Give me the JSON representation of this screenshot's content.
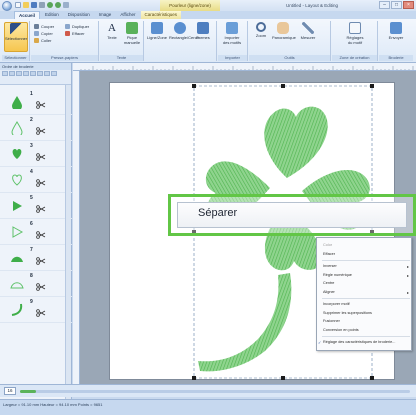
{
  "titlebar": {
    "contextual_tab_group": "Pourleur (ligne/zone)",
    "window_title": "Untitled - Layout & Editing"
  },
  "tabs": [
    "Accueil",
    "Edition",
    "Disposition",
    "Image",
    "Afficher",
    "Caractéristiques"
  ],
  "ribbon": {
    "groups": {
      "selection": "Sélectionner",
      "clipboard": "Presse-papiers",
      "text": "Texte",
      "import": "Importer",
      "tools": "Outils",
      "zone": "Zone de création",
      "embroidery": "Broderie"
    },
    "buttons": {
      "select": "Sélectionner",
      "cut": "Couper",
      "copy": "Copier",
      "paste": "Coller",
      "duplicate": "Dupliquer",
      "delete": "Effacer",
      "text": "Texte",
      "manual_punch": "Pique manuelle",
      "line_zone": "Ligne/Zone",
      "shapes": "Rectangle/Cercle",
      "forms": "Formes",
      "import_patterns": "Importer des motifs",
      "zoom": "Zoom",
      "pan": "Panoramique",
      "measure": "Mesurer",
      "pattern_settings": "Réglages du motif",
      "send": "Envoyer"
    }
  },
  "left_panel": {
    "header": "Ordre de broderie",
    "items": [
      {
        "num": "1",
        "color": "#3fae49",
        "shape": "drop"
      },
      {
        "num": "2",
        "color": "#5fc26a",
        "shape": "drop-outline"
      },
      {
        "num": "3",
        "color": "#3fae49",
        "shape": "heart"
      },
      {
        "num": "4",
        "color": "#5fc26a",
        "shape": "heart-outline"
      },
      {
        "num": "5",
        "color": "#3fae49",
        "shape": "triangle"
      },
      {
        "num": "6",
        "color": "#5fc26a",
        "shape": "triangle-outline"
      },
      {
        "num": "7",
        "color": "#3fae49",
        "shape": "mound"
      },
      {
        "num": "8",
        "color": "#5fc26a",
        "shape": "mound-outline"
      },
      {
        "num": "9",
        "color": "#3fae49",
        "shape": "stem"
      }
    ]
  },
  "context_menu": {
    "items": [
      {
        "label": "Color",
        "disabled": true,
        "arrow": false
      },
      {
        "label": "Effacer",
        "disabled": false,
        "arrow": false
      },
      {
        "label": "Inverser",
        "disabled": false,
        "arrow": true
      },
      {
        "label": "Règle numérique",
        "disabled": false,
        "arrow": true
      },
      {
        "label": "Centre",
        "disabled": false,
        "arrow": false
      },
      {
        "label": "Aligner",
        "disabled": false,
        "arrow": true
      },
      {
        "label": "Incorporer motif",
        "disabled": false,
        "arrow": false
      },
      {
        "label": "Supprimer les superpositions",
        "disabled": false,
        "arrow": false
      },
      {
        "label": "Fusionner",
        "disabled": false,
        "arrow": false
      },
      {
        "label": "Conversion en points",
        "disabled": false,
        "arrow": false
      },
      {
        "label": "Réglage des caractéristiques de broderie...",
        "disabled": false,
        "arrow": false,
        "checked": true
      }
    ],
    "zoomed_label": "Séparer"
  },
  "zoom": {
    "value": "16",
    "fraction": 0.04
  },
  "status": "Largeur = 91.10 mm Hauteur = 94.10 mm Points = 9651",
  "colors": {
    "accent_green": "#62c646",
    "stitch_green": "#5fc26a",
    "ribbon_blue": "#c6d8ef"
  },
  "icons": [
    "app-orb-icon",
    "scissors-icon",
    "copy-icon",
    "paste-icon",
    "text-icon",
    "zoom-icon",
    "hand-icon"
  ]
}
